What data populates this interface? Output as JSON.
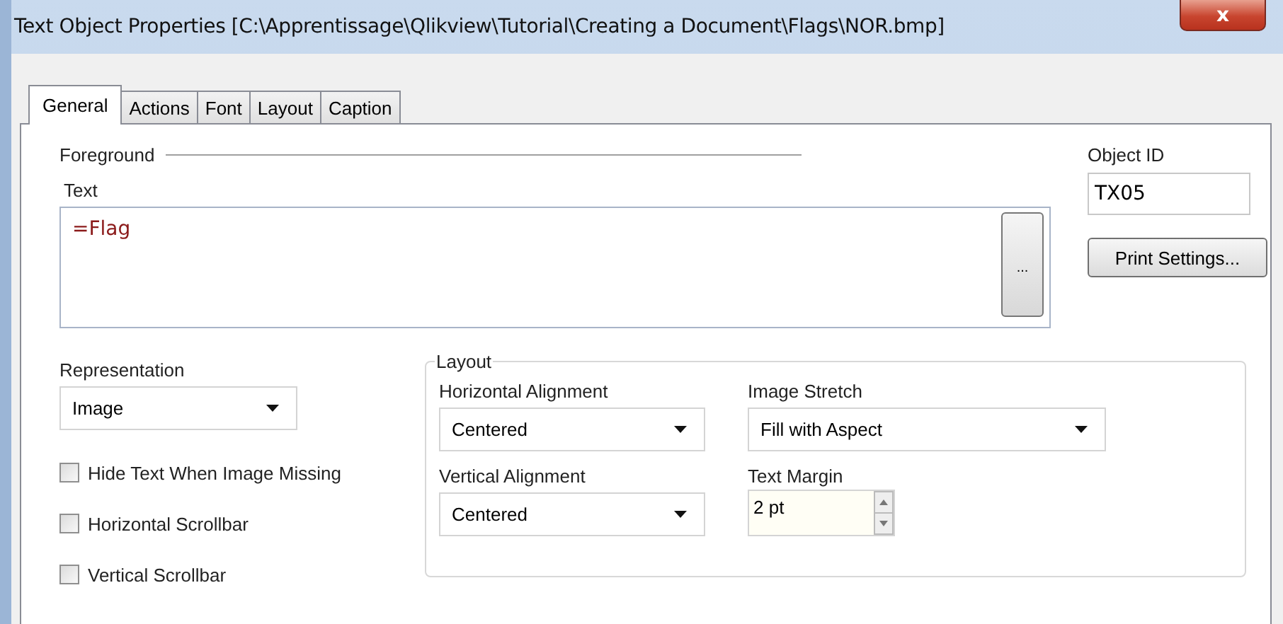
{
  "window": {
    "title": "Text Object Properties [C:\\Apprentissage\\Qlikview\\Tutorial\\Creating a Document\\Flags\\NOR.bmp]",
    "close": "x"
  },
  "tabs": [
    {
      "label": "General",
      "selected": true
    },
    {
      "label": "Actions",
      "selected": false
    },
    {
      "label": "Font",
      "selected": false
    },
    {
      "label": "Layout",
      "selected": false
    },
    {
      "label": "Caption",
      "selected": false
    }
  ],
  "foreground": {
    "title": "Foreground",
    "text_label": "Text",
    "text_value": "=Flag",
    "browse_button": "..."
  },
  "object_id": {
    "label": "Object ID",
    "value": "TX05"
  },
  "print_settings_button": "Print Settings...",
  "representation": {
    "label": "Representation",
    "value": "Image"
  },
  "checkboxes": [
    {
      "label": "Hide Text When Image Missing",
      "checked": false
    },
    {
      "label": "Horizontal Scrollbar",
      "checked": false
    },
    {
      "label": "Vertical Scrollbar",
      "checked": false
    }
  ],
  "layout": {
    "title": "Layout",
    "horizontal_alignment": {
      "label": "Horizontal Alignment",
      "value": "Centered"
    },
    "image_stretch": {
      "label": "Image Stretch",
      "value": "Fill with Aspect"
    },
    "vertical_alignment": {
      "label": "Vertical Alignment",
      "value": "Centered"
    },
    "text_margin": {
      "label": "Text Margin",
      "value": "2 pt"
    }
  }
}
